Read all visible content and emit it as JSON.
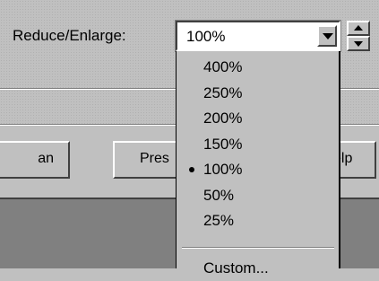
{
  "zoom_control": {
    "label": "Reduce/Enlarge:",
    "value": "100%",
    "options": [
      "400%",
      "250%",
      "200%",
      "150%",
      "100%",
      "50%",
      "25%"
    ],
    "selected_index": 4,
    "extra_option": "Custom..."
  },
  "buttons": {
    "left_partial": "an",
    "middle_partial": "Pres",
    "right_partial": "elp"
  },
  "icons": {
    "combo_arrow": "chevron-down-icon",
    "spin_up": "chevron-up-icon",
    "spin_down": "chevron-down-icon",
    "selected_marker": "bullet-icon"
  }
}
